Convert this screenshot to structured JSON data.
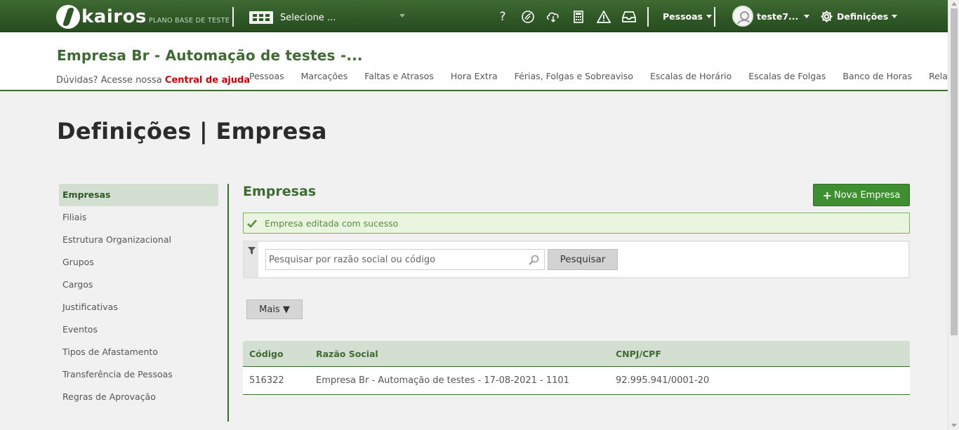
{
  "topbar": {
    "logo_text": "kairos",
    "logo_sub": "PLANO BASE DE TESTE",
    "company_select": "Selecione ...",
    "icons": [
      "help-icon",
      "dollar-leaf-icon",
      "cloud-download-icon",
      "calculator-icon",
      "warning-icon",
      "inbox-icon"
    ],
    "help_glyph": "?",
    "pessoas_menu": "Pessoas",
    "user_name": "teste7...",
    "settings_menu": "Definições"
  },
  "header": {
    "company_title": "Empresa Br - Automação de testes -...",
    "help_prefix": "Dúvidas? Acesse nossa",
    "help_link": "Central de ajuda",
    "nav": [
      "Pessoas",
      "Marcações",
      "Faltas e Atrasos",
      "Hora Extra",
      "Férias, Folgas e Sobreaviso",
      "Escalas de Horário",
      "Escalas de Folgas",
      "Banco de Horas",
      "Relatórios"
    ]
  },
  "page": {
    "title": "Definições | Empresa"
  },
  "sidebar": {
    "items": [
      "Empresas",
      "Filiais",
      "Estrutura Organizacional",
      "Grupos",
      "Cargos",
      "Justificativas",
      "Eventos",
      "Tipos de Afastamento",
      "Transferência de Pessoas",
      "Regras de Aprovação"
    ],
    "active": "Empresas"
  },
  "content": {
    "section_title": "Empresas",
    "new_button": "Nova Empresa",
    "alert": "Empresa editada com sucesso",
    "search_placeholder": "Pesquisar por razão social ou código",
    "search_button": "Pesquisar",
    "more_button": "Mais ▼",
    "table": {
      "headers": [
        "Código",
        "Razão Social",
        "CNPJ/CPF"
      ],
      "rows": [
        [
          "516322",
          "Empresa Br - Automação de testes - 17-08-2021 - 1101",
          "92.995.941/0001-20"
        ]
      ]
    }
  },
  "colors": {
    "brand_green": "#3f6a32",
    "button_green": "#3d8f2f",
    "help_red": "#d40000",
    "active_bg": "#d3e0d1"
  }
}
